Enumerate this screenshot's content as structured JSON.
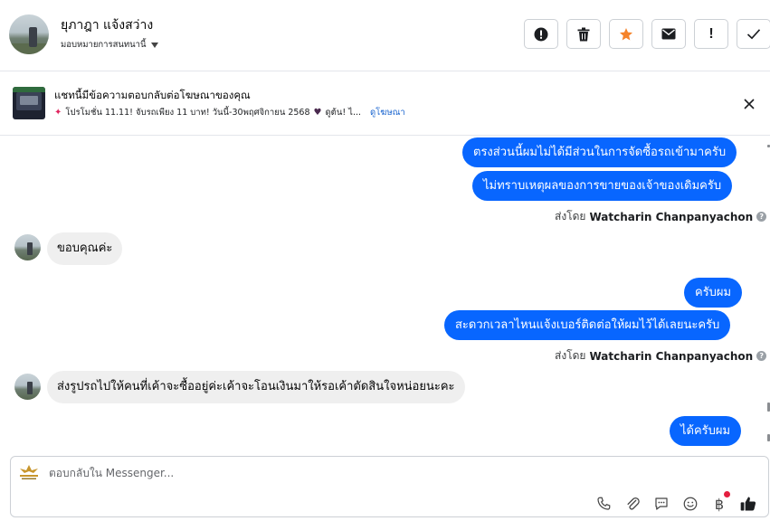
{
  "header": {
    "user_name": "ยุภาฎา แจ้งสว่าง",
    "assign_label": "มอบหมายการสนทนานี้",
    "actions": [
      {
        "name": "report-spam-icon",
        "label": ""
      },
      {
        "name": "delete-icon",
        "label": ""
      },
      {
        "name": "star-icon",
        "label": ""
      },
      {
        "name": "mark-unread-icon",
        "label": ""
      },
      {
        "name": "exclamation-icon",
        "label": "!"
      },
      {
        "name": "done-check-icon",
        "label": ""
      }
    ]
  },
  "ad": {
    "title": "แชทนี้มีข้อความตอบกลับต่อโฆษณาของคุณ",
    "subtitle": "โปรโมชั่น 11.11! จับรถเพียง 11 บาท! วันนี้-30พฤศจิกายน 2568",
    "subtitle_tail": "ดูต้น! ไ...",
    "link": "ดูโฆษณา"
  },
  "messages": {
    "out1": "ตรงส่วนนี้ผมไม่ได้มีส่วนในการจัดซื้อรถเข้ามาครับ",
    "out2": "ไม่ทราบเหตุผลของการขายของเจ้าของเดิมครับ",
    "sent_by_label": "ส่งโดย",
    "sent_by_name": "Watcharin Chanpanyachon",
    "in1": "ขอบคุณค่ะ",
    "out3": "ครับผม",
    "out4": "สะดวกเวลาไหนแจ้งเบอร์ติดต่อให้ผมไว้ได้เลยนะครับ",
    "in2": "ส่งรูปรถไปให้คนที่เค้าจะซื้ออยู่ค่ะเค้าจะโอนเงินมาให้รอเค้าตัดสินใจหน่อยนะคะ",
    "out5": "ได้ครับผม"
  },
  "composer": {
    "placeholder": "ตอบกลับใน Messenger...",
    "tools": [
      "phone-icon",
      "attachment-icon",
      "saved-reply-icon",
      "emoji-icon",
      "baht-icon",
      "like-icon"
    ],
    "baht_symbol": "฿"
  },
  "colors": {
    "outgoing_bubble": "#0866ff",
    "incoming_bubble": "#efefef",
    "star": "#f5832a",
    "link": "#1763cf"
  }
}
